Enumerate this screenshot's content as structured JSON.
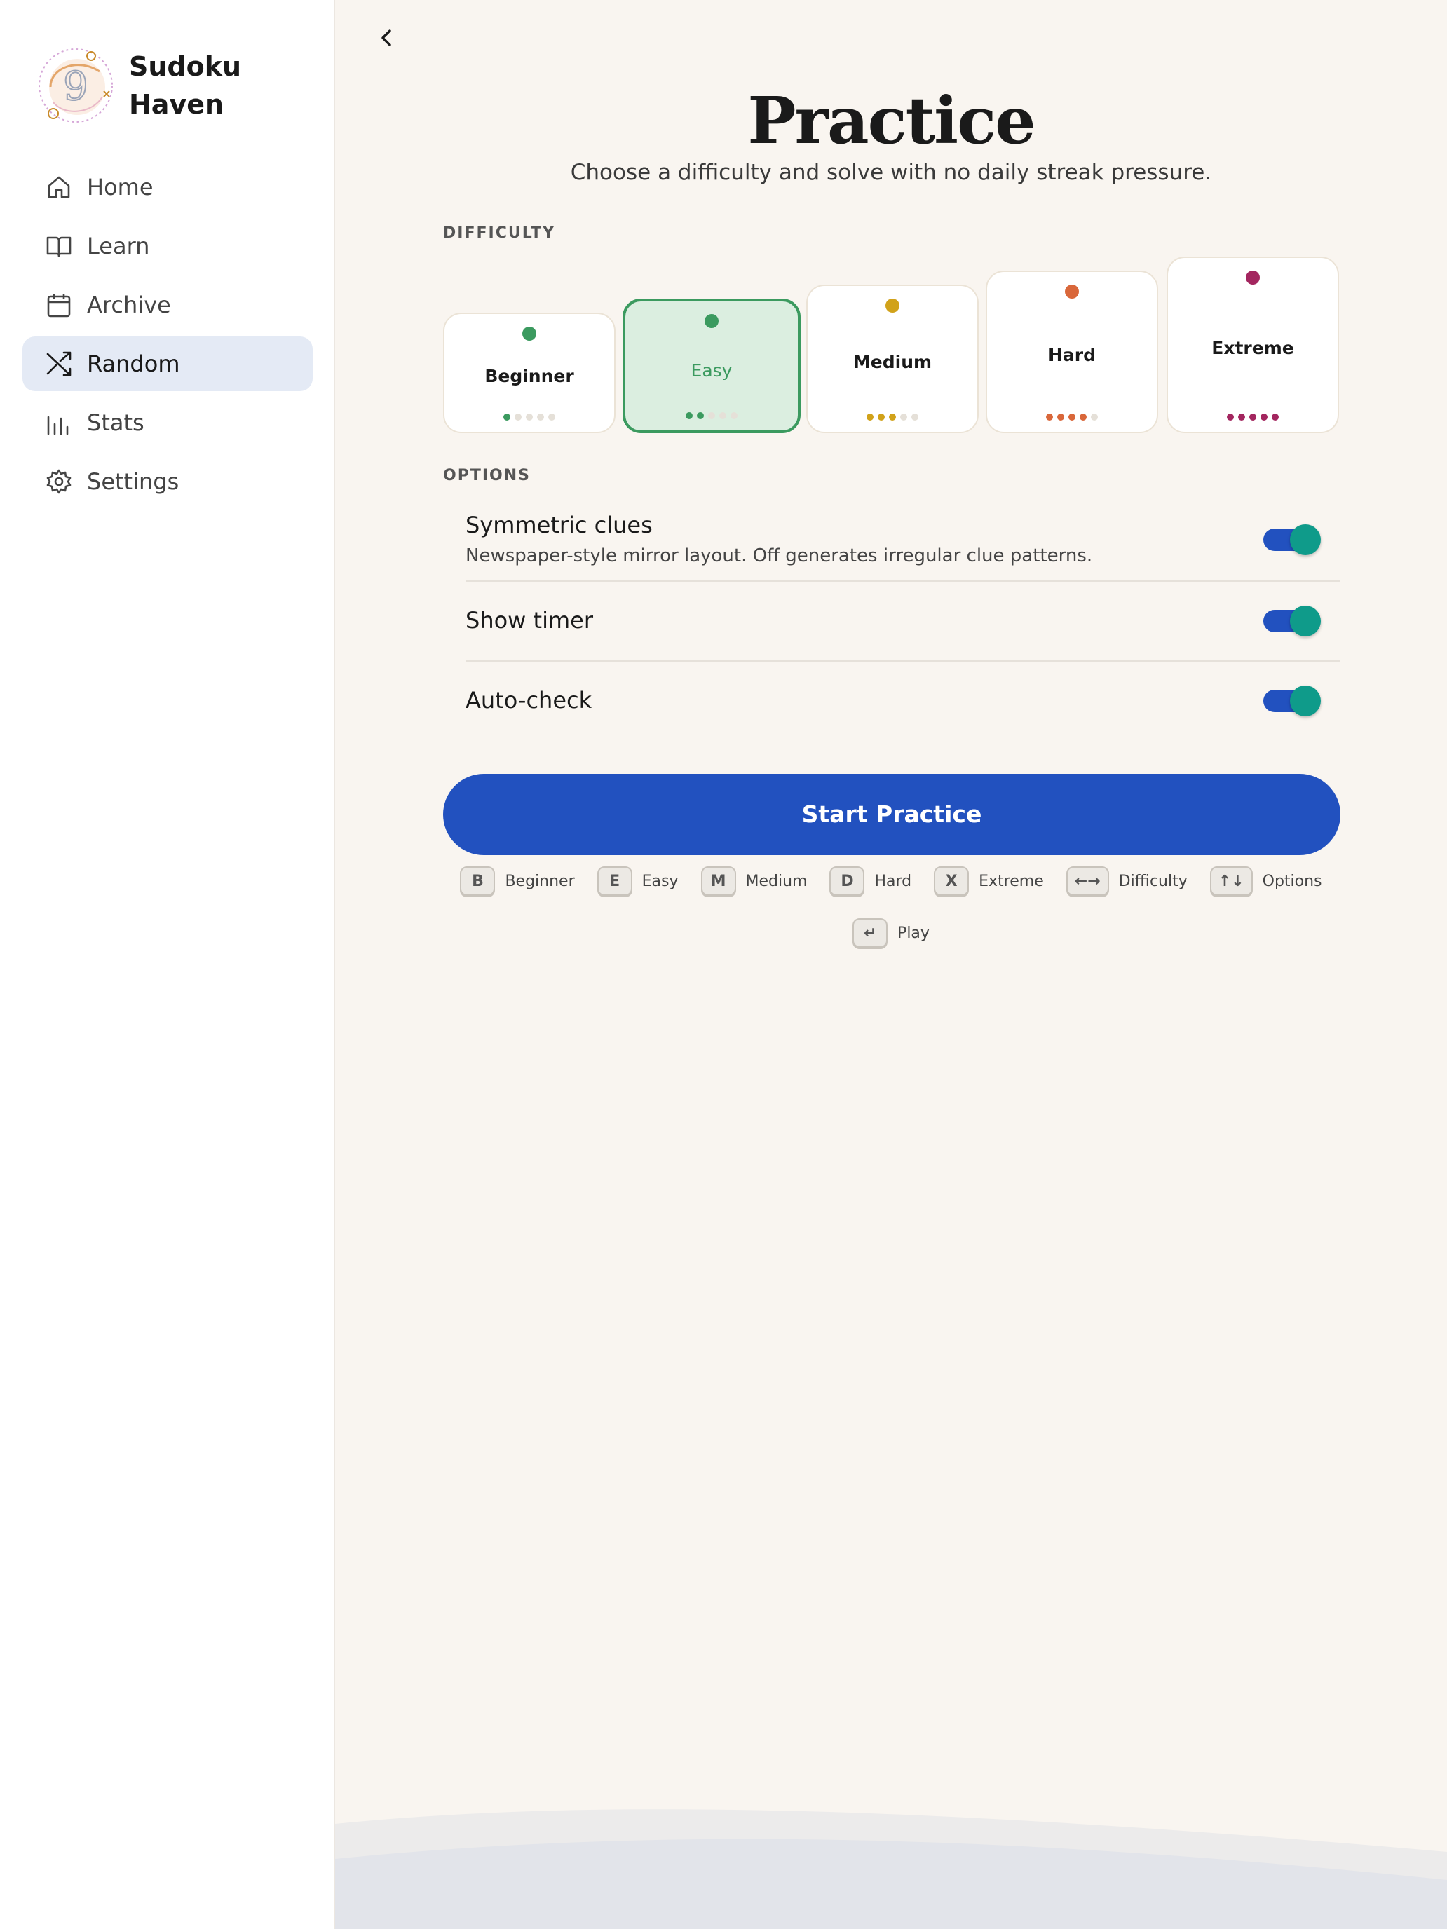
{
  "app": {
    "name": "Sudoku Haven",
    "logo_digit": "9"
  },
  "sidebar": {
    "items": [
      {
        "label": "Home",
        "icon": "home-icon",
        "active": false
      },
      {
        "label": "Learn",
        "icon": "book-icon",
        "active": false
      },
      {
        "label": "Archive",
        "icon": "calendar-icon",
        "active": false
      },
      {
        "label": "Random",
        "icon": "shuffle-icon",
        "active": true
      },
      {
        "label": "Stats",
        "icon": "bar-chart-icon",
        "active": false
      },
      {
        "label": "Settings",
        "icon": "gear-icon",
        "active": false
      }
    ]
  },
  "page": {
    "title": "Practice",
    "subtitle": "Choose a difficulty and solve with no daily streak pressure."
  },
  "difficulty": {
    "section_label": "DIFFICULTY",
    "selected": "Easy",
    "levels": [
      {
        "label": "Beginner",
        "color": "#3b9a5f",
        "level": 1
      },
      {
        "label": "Easy",
        "color": "#3b9a5f",
        "level": 2
      },
      {
        "label": "Medium",
        "color": "#d1a21a",
        "level": 3
      },
      {
        "label": "Hard",
        "color": "#d9673a",
        "level": 4
      },
      {
        "label": "Extreme",
        "color": "#a3265f",
        "level": 5
      }
    ]
  },
  "options": {
    "section_label": "OPTIONS",
    "items": [
      {
        "title": "Symmetric clues",
        "description": "Newspaper-style mirror layout. Off generates irregular clue patterns.",
        "enabled": true
      },
      {
        "title": "Show timer",
        "description": "",
        "enabled": true
      },
      {
        "title": "Auto-check",
        "description": "",
        "enabled": true
      }
    ]
  },
  "start_button": {
    "label": "Start Practice"
  },
  "shortcuts": [
    {
      "key": "B",
      "label": "Beginner"
    },
    {
      "key": "E",
      "label": "Easy"
    },
    {
      "key": "M",
      "label": "Medium"
    },
    {
      "key": "D",
      "label": "Hard"
    },
    {
      "key": "X",
      "label": "Extreme"
    },
    {
      "key": "←→",
      "label": "Difficulty"
    },
    {
      "key": "↑↓",
      "label": "Options"
    },
    {
      "key": "↵",
      "label": "Play"
    }
  ],
  "colors": {
    "accent": "#2251bf",
    "toggle_knob": "#0f9b8a",
    "selected_bg": "#dbeee0",
    "background": "#f9f5f0"
  }
}
